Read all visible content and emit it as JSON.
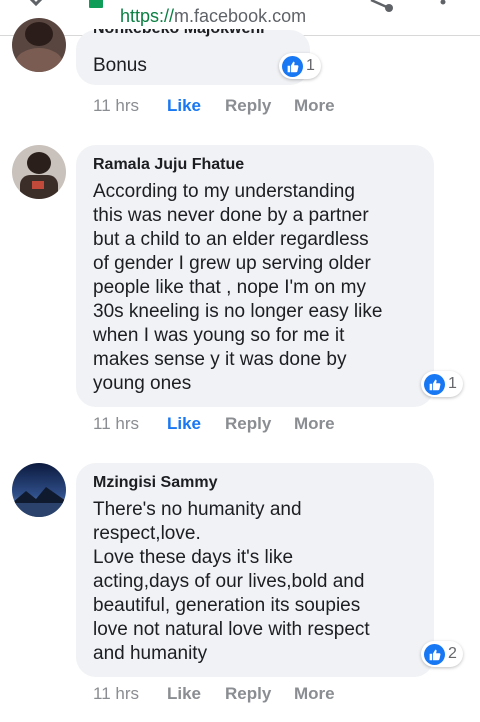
{
  "browser": {
    "url_protocol": "https://",
    "url_host": "m.facebook.com"
  },
  "comments": [
    {
      "author": "Nonkebeko Majokweni",
      "lines": [
        "Bonus"
      ],
      "reaction_count": "1",
      "time": "11 hrs",
      "like": "Like",
      "reply": "Reply",
      "more": "More",
      "liked": true
    },
    {
      "author": "Ramala Juju Fhatue",
      "lines": [
        "According to my understanding",
        "this was never done by a partner",
        "but a child to an elder regardless",
        "of gender I grew up serving older",
        "people like that , nope I'm on my",
        "30s kneeling is no longer easy like",
        "when I was young so for me it",
        "makes sense y it was done by",
        "young ones"
      ],
      "reaction_count": "1",
      "time": "11 hrs",
      "like": "Like",
      "reply": "Reply",
      "more": "More",
      "liked": true
    },
    {
      "author": "Mzingisi Sammy",
      "lines": [
        "There's no humanity and",
        "respect,love.",
        "Love these days it's like",
        "acting,days of our lives,bold and",
        "beautiful, generation its soupies",
        "love not natural love with respect",
        "and humanity"
      ],
      "reaction_count": "2",
      "time": "11 hrs",
      "like": "Like",
      "reply": "Reply",
      "more": "More",
      "liked": false
    }
  ],
  "icons": {
    "close": "close-icon",
    "lock": "lock-icon",
    "share": "share-icon",
    "menu": "more-vert-icon",
    "like": "like-thumb-icon"
  },
  "colors": {
    "facebook_blue": "#1877f2",
    "bubble": "#f0f2f5",
    "secure_green": "#0b8043",
    "action_gray": "#8a8d91"
  }
}
